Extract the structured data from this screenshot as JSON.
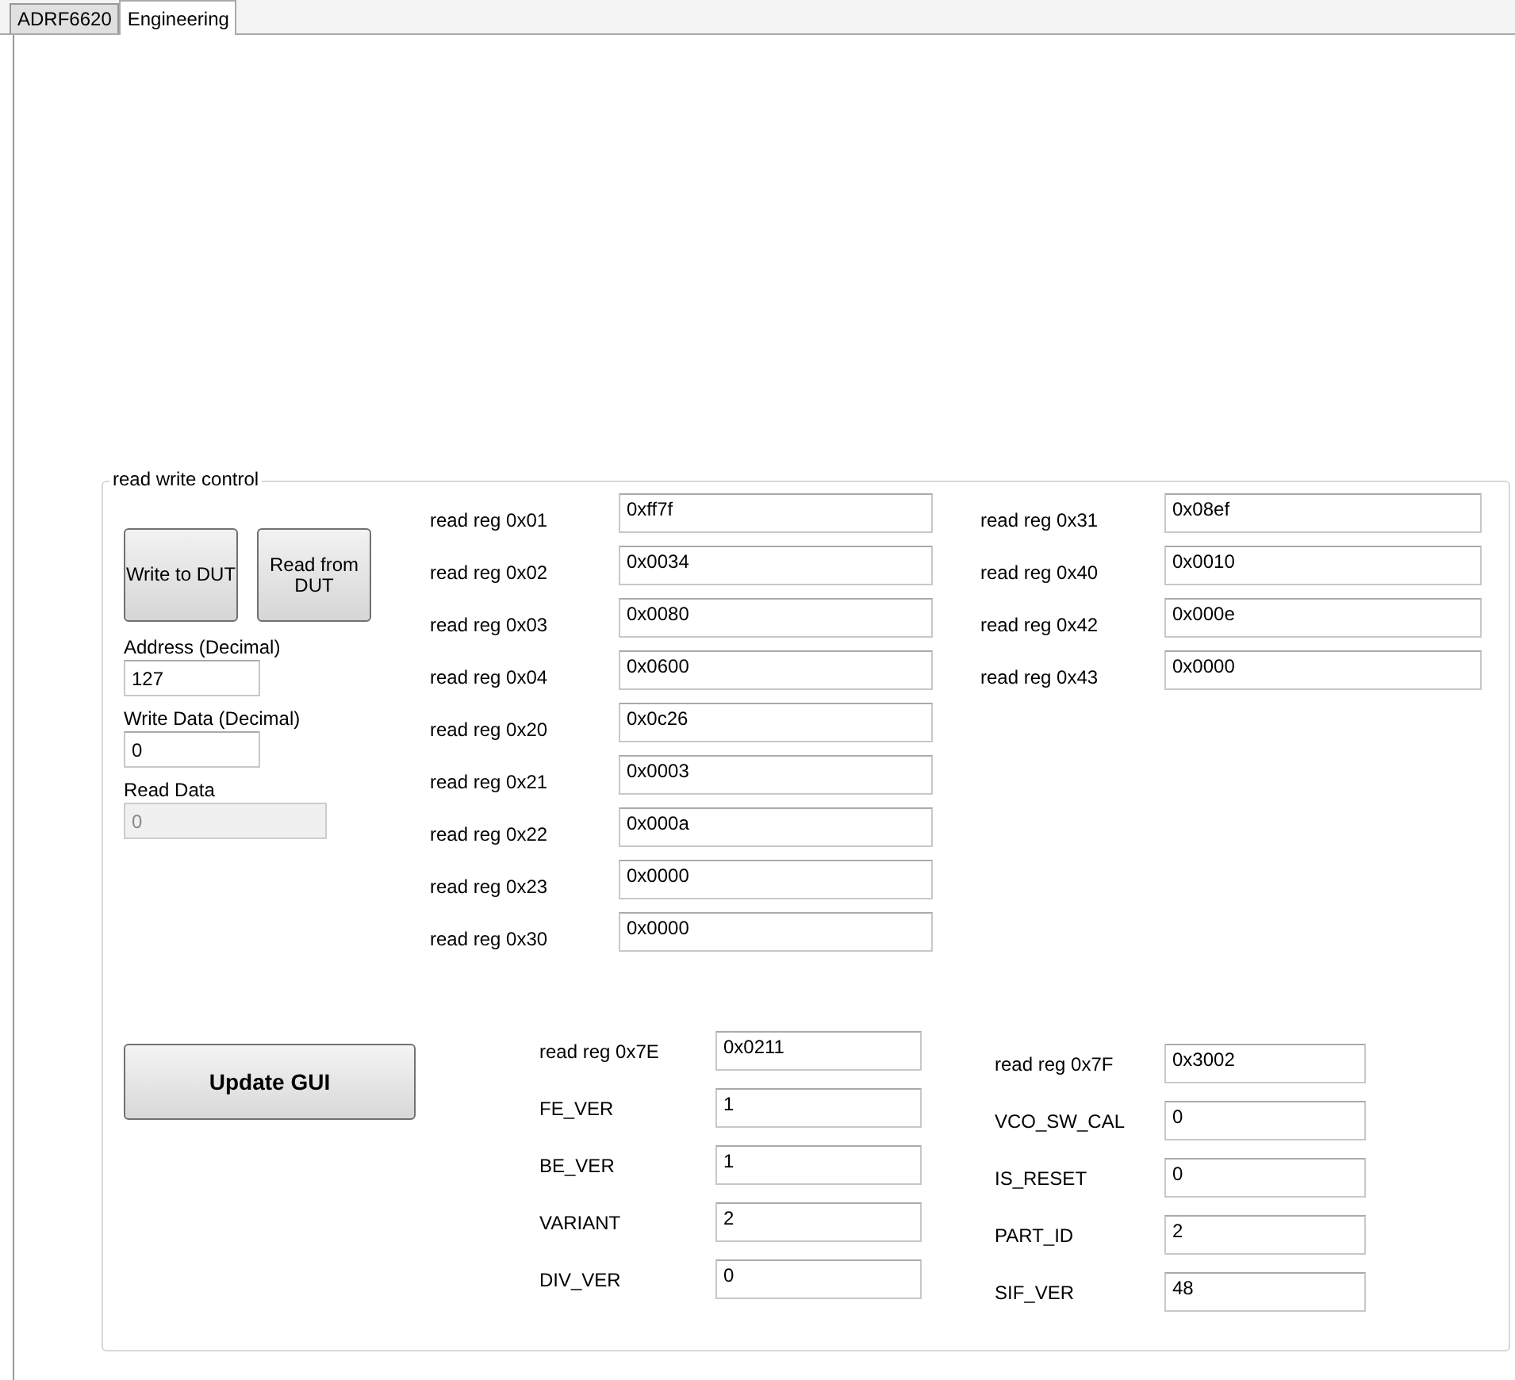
{
  "tabs": [
    {
      "label": "ADRF6620",
      "selected": false
    },
    {
      "label": "Engineering",
      "selected": true
    }
  ],
  "group": {
    "title": "read write control",
    "buttons": [
      "Write to DUT",
      "Read from DUT"
    ],
    "fields": [
      {
        "label": "Address (Decimal)",
        "value": "127",
        "disabled": false
      },
      {
        "label": "Write Data (Decimal)",
        "value": "0",
        "disabled": false
      },
      {
        "label": "Read Data",
        "value": "0",
        "disabled": true
      }
    ],
    "registers_left": [
      {
        "label": "read reg 0x01",
        "value": "0xff7f"
      },
      {
        "label": "read reg 0x02",
        "value": "0x0034"
      },
      {
        "label": "read reg 0x03",
        "value": "0x0080"
      },
      {
        "label": "read reg 0x04",
        "value": "0x0600"
      },
      {
        "label": "read reg 0x20",
        "value": "0x0c26"
      },
      {
        "label": "read reg 0x21",
        "value": "0x0003"
      },
      {
        "label": "read reg 0x22",
        "value": "0x000a"
      },
      {
        "label": "read reg 0x23",
        "value": "0x0000"
      },
      {
        "label": "read reg 0x30",
        "value": "0x0000"
      }
    ],
    "registers_right": [
      {
        "label": "read reg 0x31",
        "value": "0x08ef"
      },
      {
        "label": "read reg 0x40",
        "value": "0x0010"
      },
      {
        "label": "read reg 0x42",
        "value": "0x000e"
      },
      {
        "label": "read reg 0x43",
        "value": "0x0000"
      }
    ],
    "update_button": "Update GUI",
    "info_left": [
      {
        "label": "read reg 0x7E",
        "value": "0x0211"
      },
      {
        "label": "FE_VER",
        "value": "1"
      },
      {
        "label": "BE_VER",
        "value": "1"
      },
      {
        "label": "VARIANT",
        "value": "2"
      },
      {
        "label": "DIV_VER",
        "value": "0"
      }
    ],
    "info_right": [
      {
        "label": "read reg 0x7F",
        "value": "0x3002"
      },
      {
        "label": "VCO_SW_CAL",
        "value": "0"
      },
      {
        "label": "IS_RESET",
        "value": "0"
      },
      {
        "label": "PART_ID",
        "value": "2"
      },
      {
        "label": "SIF_VER",
        "value": "48"
      }
    ]
  }
}
